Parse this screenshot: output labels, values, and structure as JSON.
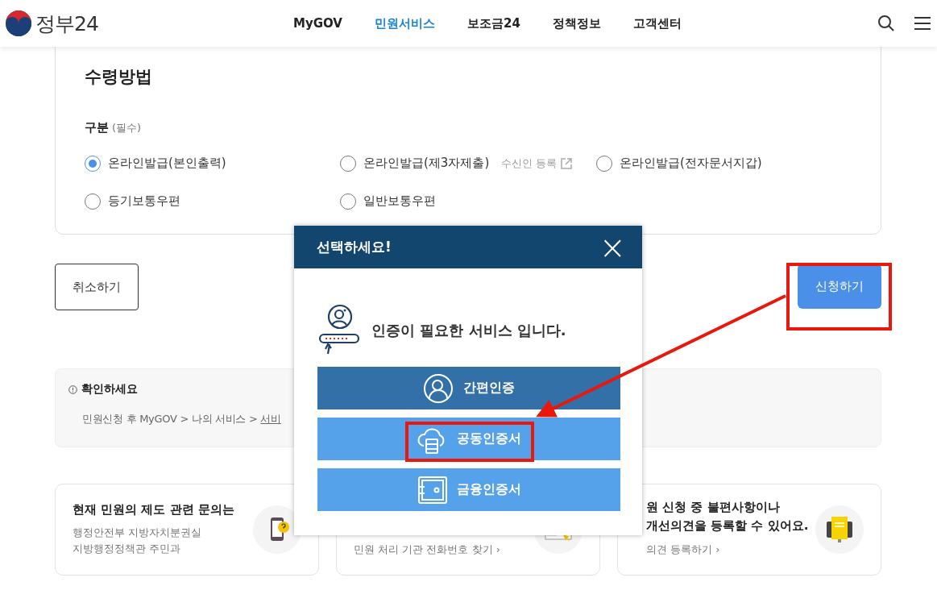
{
  "header": {
    "logo_text": "정부24",
    "nav": [
      {
        "label": "MyGOV",
        "selected": false
      },
      {
        "label": "민원서비스",
        "selected": true
      },
      {
        "label": "보조금24",
        "selected": false
      },
      {
        "label": "정책정보",
        "selected": false
      },
      {
        "label": "고객센터",
        "selected": false
      }
    ]
  },
  "section": {
    "title": "수령방법",
    "field_label": "구분",
    "required_note": "(필수)",
    "options": [
      {
        "label": "온라인발급(본인출력)",
        "selected": true
      },
      {
        "label": "온라인발급(제3자제출)",
        "selected": false,
        "link": "수신인 등록"
      },
      {
        "label": "온라인발급(전자문서지갑)",
        "selected": false
      },
      {
        "label": "등기보통우편",
        "selected": false
      },
      {
        "label": "일반보통우편",
        "selected": false
      }
    ]
  },
  "buttons": {
    "cancel": "취소하기",
    "submit": "신청하기"
  },
  "notice": {
    "title": "확인하세요",
    "text": "민원신청 후 MyGOV > 나의 서비스 > ",
    "link": "서비"
  },
  "cards": [
    {
      "kind": "phone",
      "title": [
        "현재 민원의 제도 관련 문의는"
      ],
      "lines": [
        "행정안전부 지방자치분권실",
        "지방행정정책관 주민과"
      ]
    },
    {
      "kind": "document",
      "link": "민원 처리 기관 전화번호 찾기 ›"
    },
    {
      "kind": "monitor",
      "title": [
        "원 신청 중 불편사항이나",
        "개선의견을 등록할 수 있어요."
      ],
      "link": "의견 등록하기 ›"
    }
  ],
  "modal": {
    "title": "선택하세요!",
    "close": "×",
    "message": "인증이 필요한 서비스 입니다.",
    "options": [
      {
        "kind": "simple",
        "label": "간편인증",
        "selected": true
      },
      {
        "kind": "joint",
        "label": "공동인증서",
        "selected": false
      },
      {
        "kind": "financial",
        "label": "금융인증서",
        "selected": false
      }
    ]
  }
}
